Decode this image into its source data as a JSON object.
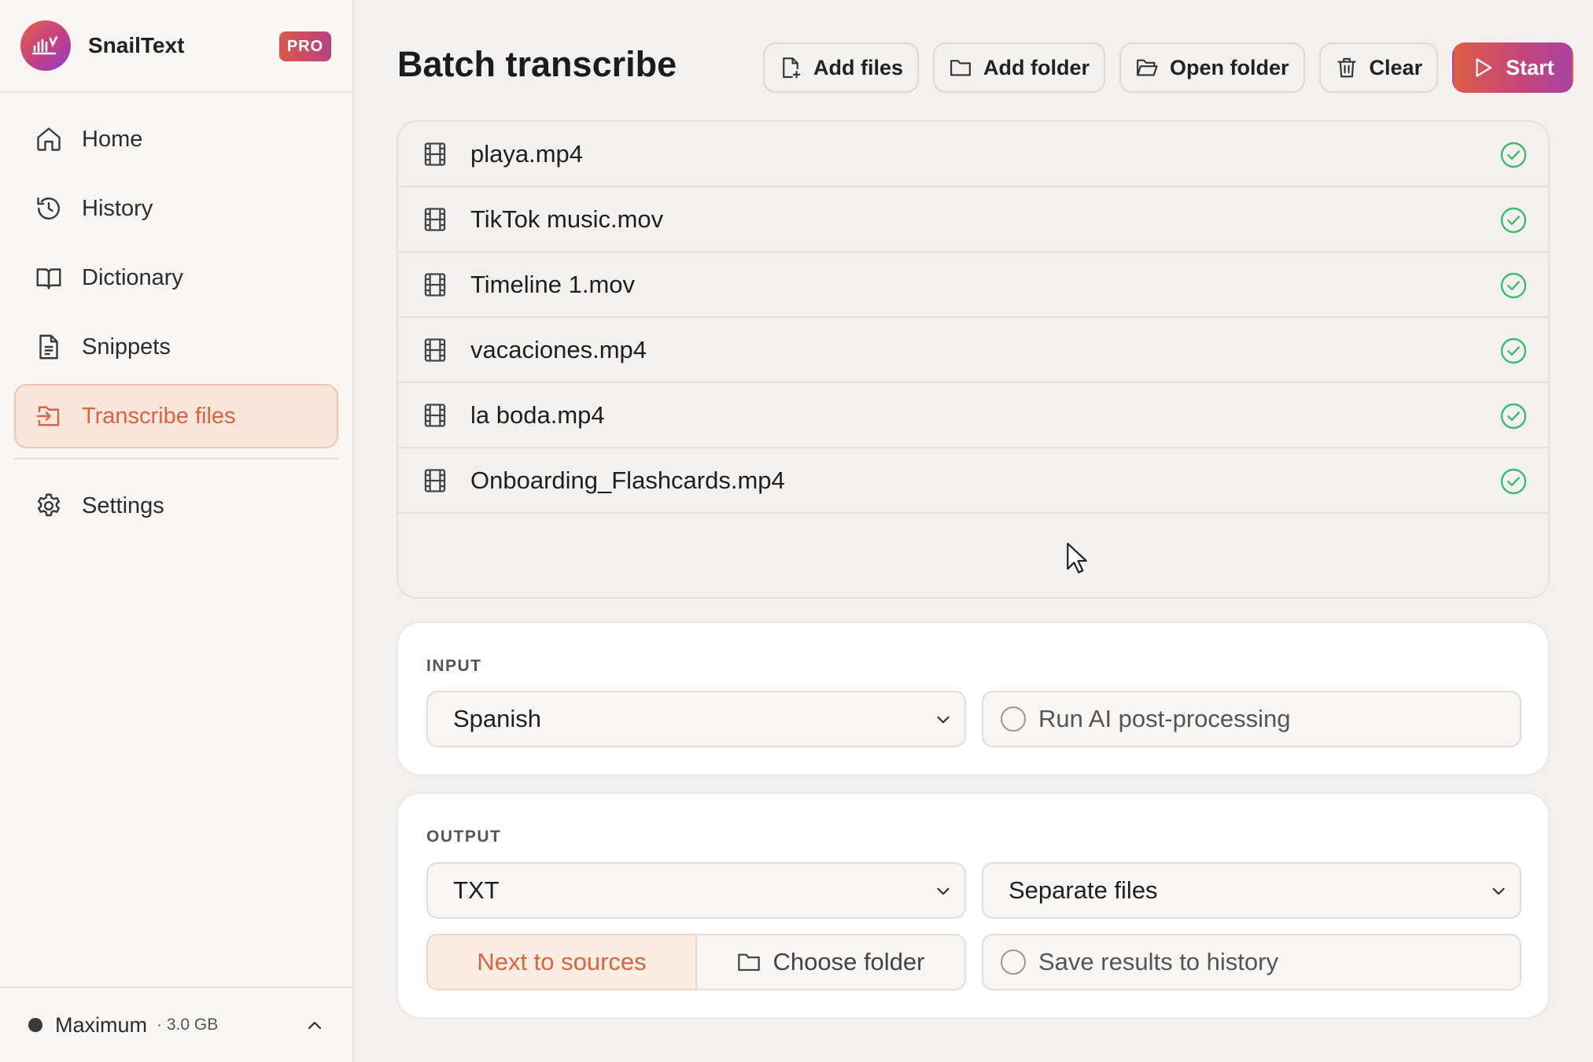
{
  "app": {
    "name": "SnailText",
    "badge": "PRO"
  },
  "sidebar": {
    "items": [
      {
        "label": "Home",
        "icon": "home-icon"
      },
      {
        "label": "History",
        "icon": "history-icon"
      },
      {
        "label": "Dictionary",
        "icon": "book-icon"
      },
      {
        "label": "Snippets",
        "icon": "document-icon"
      },
      {
        "label": "Transcribe files",
        "icon": "file-import-icon",
        "active": true
      },
      {
        "label": "Settings",
        "icon": "gear-icon"
      }
    ],
    "footer": {
      "mode": "Maximum",
      "size": "· 3.0 GB"
    }
  },
  "main": {
    "title": "Batch transcribe",
    "toolbar": {
      "add_files": "Add files",
      "add_folder": "Add folder",
      "open_folder": "Open folder",
      "clear": "Clear",
      "start": "Start"
    },
    "files": [
      {
        "name": "playa.mp4",
        "status": "done"
      },
      {
        "name": "TikTok music.mov",
        "status": "done"
      },
      {
        "name": "Timeline 1.mov",
        "status": "done"
      },
      {
        "name": "vacaciones.mp4",
        "status": "done"
      },
      {
        "name": "la boda.mp4",
        "status": "done"
      },
      {
        "name": "Onboarding_Flashcards.mp4",
        "status": "done"
      }
    ],
    "input": {
      "label": "INPUT",
      "language": "Spanish",
      "ai_postprocessing": "Run AI post-processing"
    },
    "output": {
      "label": "OUTPUT",
      "format": "TXT",
      "mode": "Separate files",
      "location_active": "Next to sources",
      "location_other": "Choose folder",
      "save_history": "Save results to history"
    }
  },
  "colors": {
    "accent": "#d8653c",
    "success": "#3dbb6b",
    "start_gradient": [
      "#df5d46",
      "#a943a4"
    ]
  }
}
